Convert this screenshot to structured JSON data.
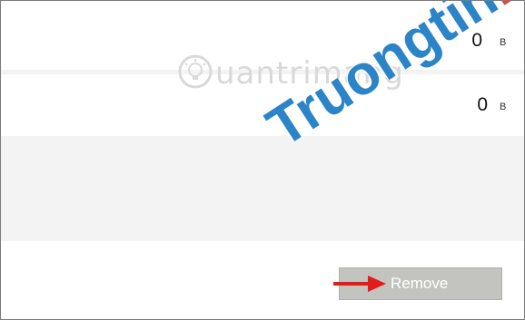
{
  "rows": [
    {
      "size_value": "0",
      "size_unit": "B"
    },
    {
      "size_value": "0",
      "size_unit": "B"
    }
  ],
  "actions": {
    "remove_label": "Remove"
  },
  "watermark": {
    "logo_text": "uantrimang",
    "big_text": "Truongtin",
    "big_suffix": ".top"
  },
  "colors": {
    "button_bg": "#c3c3bf",
    "stripe": "#f3f3f3",
    "arrow": "#e21b1b",
    "watermark_blue": "#2c84c8",
    "watermark_red": "#e04646"
  },
  "icons": [
    "red-arrow-icon",
    "lightbulb-logo-icon"
  ]
}
